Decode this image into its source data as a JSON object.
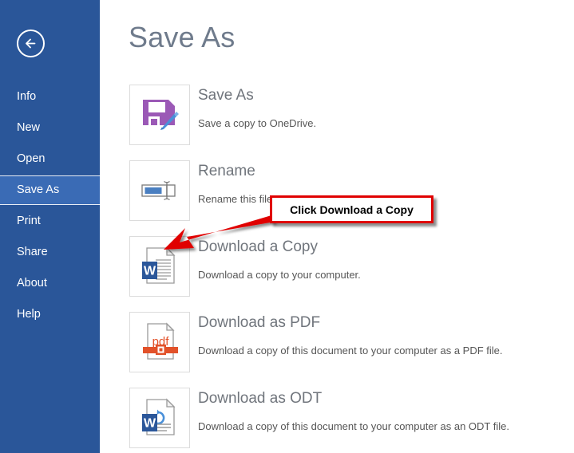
{
  "sidebar": {
    "back_button": {
      "icon": "back-arrow-icon",
      "label": "Back"
    },
    "background_color": "#2a5699",
    "selected_color": "#3a6bb5",
    "items": [
      {
        "label": "Info",
        "selected": false
      },
      {
        "label": "New",
        "selected": false
      },
      {
        "label": "Open",
        "selected": false
      },
      {
        "label": "Save As",
        "selected": true
      },
      {
        "label": "Print",
        "selected": false
      },
      {
        "label": "Share",
        "selected": false
      },
      {
        "label": "About",
        "selected": false
      },
      {
        "label": "Help",
        "selected": false
      }
    ]
  },
  "main": {
    "page_title": "Save As",
    "title_color": "#6f7b8c",
    "options": [
      {
        "icon": "floppy-disk-pencil-icon",
        "title": "Save As",
        "description": "Save a copy to OneDrive."
      },
      {
        "icon": "rename-textbox-icon",
        "title": "Rename",
        "description": "Rename this file."
      },
      {
        "icon": "word-document-icon",
        "title": "Download a Copy",
        "description": "Download a copy to your computer."
      },
      {
        "icon": "pdf-document-icon",
        "title": "Download as PDF",
        "description": "Download a copy of this document to your computer as a PDF file."
      },
      {
        "icon": "odt-document-icon",
        "title": "Download as ODT",
        "description": "Download a copy of this document to your computer as an ODT file."
      }
    ]
  },
  "annotation": {
    "callout_text": "Click Download a Copy",
    "border_color": "#e00000",
    "arrow_color": "#e00000",
    "arrow_icon": "red-pointer-arrow-icon"
  }
}
